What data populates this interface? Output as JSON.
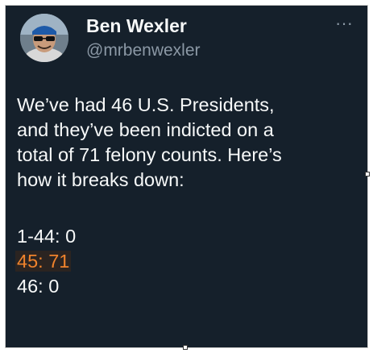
{
  "author": {
    "name": "Ben Wexler",
    "handle": "@mrbenwexler",
    "avatar_icon": "user-avatar"
  },
  "more_icon": "more-horizontal-icon",
  "more_label": "···",
  "tweet": {
    "lines": [
      "We’ve had 46 U.S. Presidents,",
      "and they’ve been indicted on a",
      "total of 71 felony counts. Here’s",
      "how it breaks down:"
    ],
    "counts": [
      "1-44: 0",
      "45: 71",
      "46: 0"
    ]
  },
  "colors": {
    "background": "#15202b",
    "text": "#f7f9f9",
    "secondary": "#8b98a5",
    "highlight": "#f0832c"
  }
}
